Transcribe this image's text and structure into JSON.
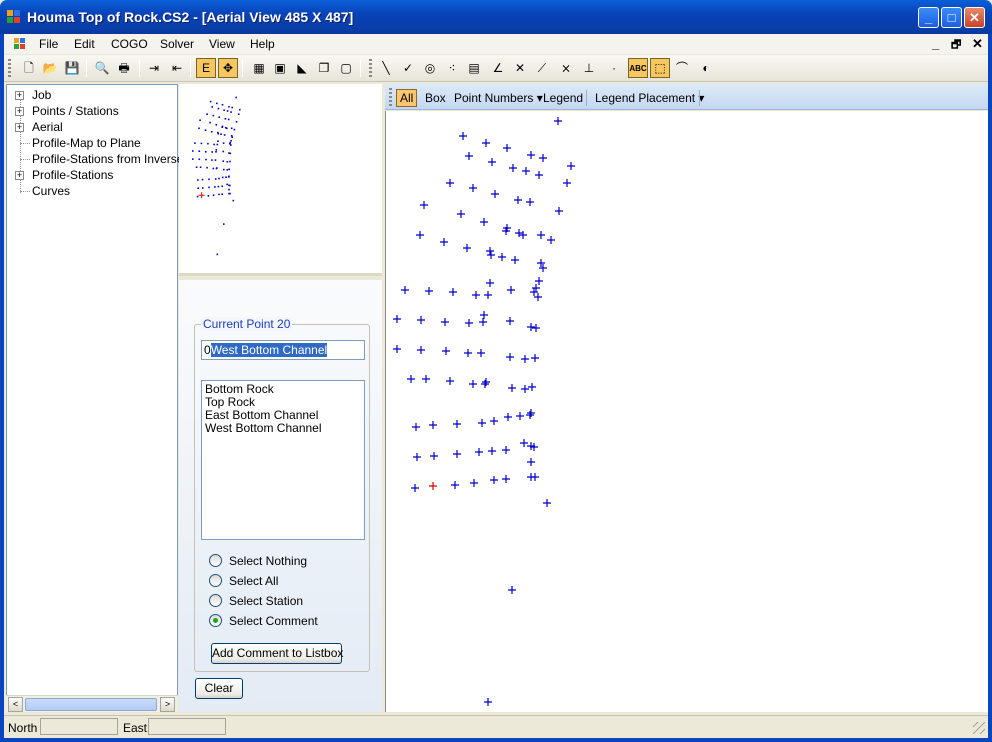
{
  "window": {
    "title": "Houma Top of Rock.CS2 - [Aerial View   485  X  487]",
    "controls": {
      "minimize": "_",
      "maximize": "□",
      "close": "✕"
    }
  },
  "menubar": {
    "items": [
      "File",
      "Edit",
      "COGO",
      "Solver",
      "View",
      "Help"
    ],
    "mdi_controls": [
      "_",
      "🗗",
      "✕"
    ]
  },
  "toolbar": {
    "buttons": [
      {
        "name": "new-icon",
        "glyph": "🗋"
      },
      {
        "name": "open-icon",
        "glyph": "📂"
      },
      {
        "name": "save-icon",
        "glyph": "💾"
      },
      {
        "name": "print-preview-icon",
        "glyph": "🔍"
      },
      {
        "name": "print-icon",
        "glyph": "🖶"
      },
      {
        "name": "export-icon",
        "glyph": "⇥"
      },
      {
        "name": "import-icon",
        "glyph": "⇤"
      },
      {
        "name": "edit-mode-icon",
        "glyph": "E"
      },
      {
        "name": "zoom-extents-icon",
        "glyph": "✥"
      },
      {
        "name": "grid-icon",
        "glyph": "▦"
      },
      {
        "name": "frame-icon",
        "glyph": "▣"
      },
      {
        "name": "profile-icon",
        "glyph": "◣"
      },
      {
        "name": "copy-icon",
        "glyph": "❐"
      },
      {
        "name": "window-icon",
        "glyph": "▢"
      },
      {
        "name": "line-icon",
        "glyph": "╲"
      },
      {
        "name": "check-icon",
        "glyph": "✓"
      },
      {
        "name": "measure-icon",
        "glyph": "◎"
      },
      {
        "name": "points-icon",
        "glyph": "⁖"
      },
      {
        "name": "table-icon",
        "glyph": "▤"
      },
      {
        "name": "angle-icon",
        "glyph": "∠"
      },
      {
        "name": "intersect-icon",
        "glyph": "✕"
      },
      {
        "name": "offset-icon",
        "glyph": "⟋"
      },
      {
        "name": "cross-icon",
        "glyph": "⨯"
      },
      {
        "name": "perpendicular-icon",
        "glyph": "⊥"
      },
      {
        "name": "dot-icon",
        "glyph": "·"
      },
      {
        "name": "label-edit-icon",
        "glyph": "ABC"
      },
      {
        "name": "select-icon",
        "glyph": "⬚"
      },
      {
        "name": "arc-icon",
        "glyph": "⌒"
      },
      {
        "name": "circle-icon",
        "glyph": "◐"
      }
    ]
  },
  "tree": {
    "items": [
      {
        "label": "Job",
        "expandable": true
      },
      {
        "label": "Points / Stations",
        "expandable": true
      },
      {
        "label": "Aerial",
        "expandable": true
      },
      {
        "label": "Profile-Map to Plane",
        "expandable": false
      },
      {
        "label": "Profile-Stations from Inverse",
        "expandable": false
      },
      {
        "label": "Profile-Stations",
        "expandable": true
      },
      {
        "label": "Curves",
        "expandable": false
      }
    ],
    "scroll_left": "<",
    "scroll_right": ">"
  },
  "panel": {
    "group_title": "Current Point 20",
    "input_prefix": "0",
    "input_selected": "West Bottom Channel",
    "list": [
      "Bottom Rock",
      "Top Rock",
      "East Bottom Channel",
      "West Bottom Channel"
    ],
    "radios": [
      {
        "label": "Select Nothing",
        "checked": false
      },
      {
        "label": "Select All",
        "checked": false
      },
      {
        "label": "Select Station",
        "checked": false
      },
      {
        "label": "Select Comment",
        "checked": true
      }
    ],
    "add_button": "Add Comment to Listbox",
    "clear_button": "Clear"
  },
  "viewstrip": {
    "all": "All",
    "box": "Box",
    "point_numbers": "Point Numbers",
    "legend": "Legend",
    "legend_placement": "Legend Placement",
    "dropdown_arrow": "▾"
  },
  "view": {
    "point_color": "#0000cc",
    "current_point_color": "#e00000"
  },
  "statusbar": {
    "north_label": "North",
    "east_label": "East"
  }
}
